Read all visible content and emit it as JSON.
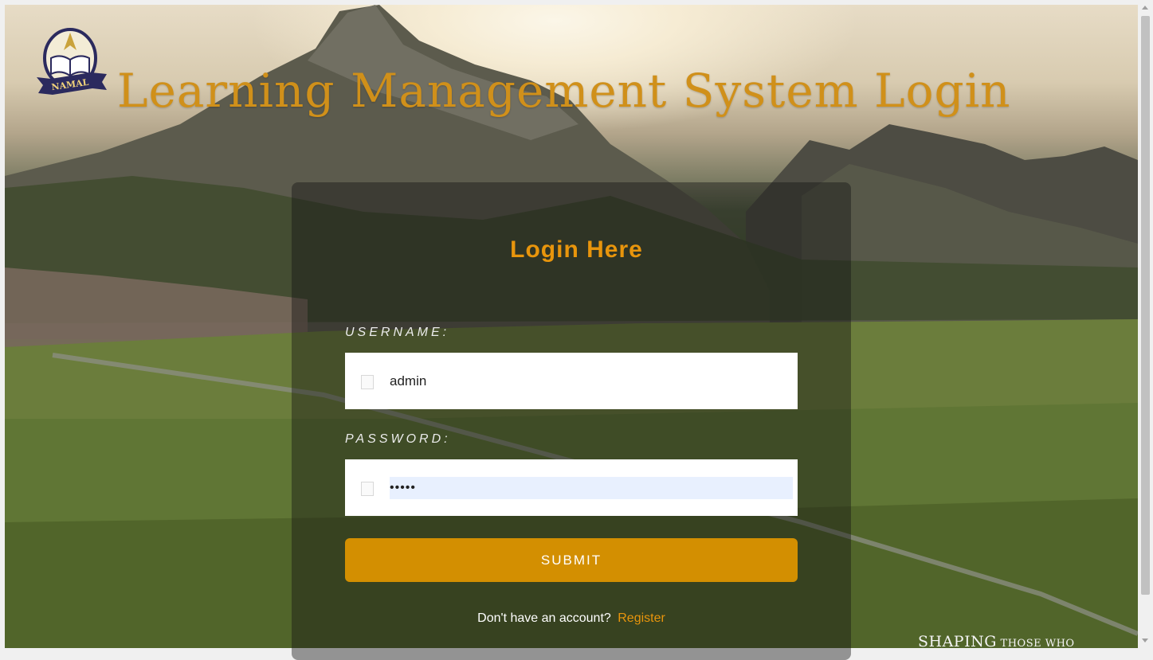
{
  "header": {
    "logo_icon": "namal-crest-icon",
    "logo_text": "NAMAL",
    "title": "Learning Management System Login"
  },
  "login": {
    "heading": "Login Here",
    "username_label": "USERNAME:",
    "username_value": "admin",
    "password_label": "PASSWORD:",
    "password_value": "•••••",
    "submit_label": "SUBMIT",
    "register_prompt": "Don't have an account?",
    "register_link": "Register"
  },
  "background": {
    "tagline_big": "SHAPING",
    "tagline_small": " THOSE WHO"
  },
  "colors": {
    "accent": "#d38f01",
    "title": "#d0901a",
    "heading": "#e8950c"
  }
}
